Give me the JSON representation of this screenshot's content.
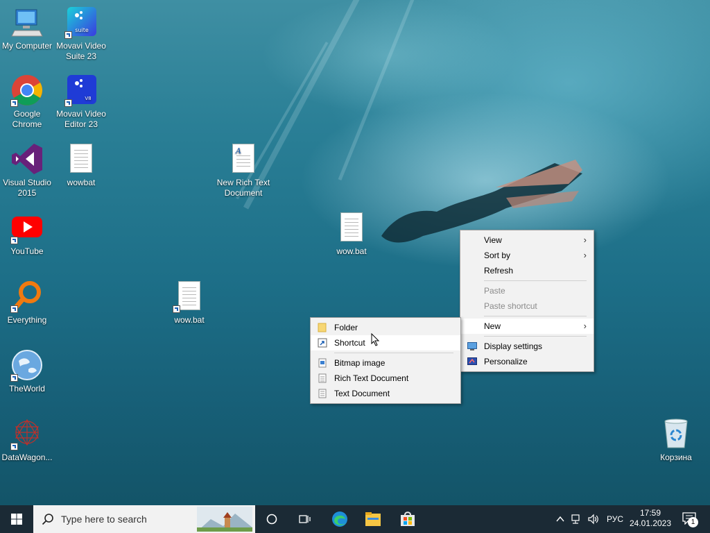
{
  "desktop": {
    "icons": [
      {
        "label": "My Computer"
      },
      {
        "label": "Movavi Video Suite 23",
        "badge": "suite"
      },
      {
        "label": "Google Chrome"
      },
      {
        "label": "Movavi Video Editor 23",
        "badge": "V8"
      },
      {
        "label": "Visual Studio 2015"
      },
      {
        "label": "wowbat"
      },
      {
        "label": "New Rich Text Document"
      },
      {
        "label": "YouTube"
      },
      {
        "label": "wow.bat"
      },
      {
        "label": "Everything"
      },
      {
        "label": "wow.bat"
      },
      {
        "label": "TheWorld"
      },
      {
        "label": "DataWagon..."
      },
      {
        "label": "Корзина"
      }
    ]
  },
  "context_menu": {
    "items": [
      {
        "label": "View"
      },
      {
        "label": "Sort by"
      },
      {
        "label": "Refresh"
      },
      {
        "label": "Paste"
      },
      {
        "label": "Paste shortcut"
      },
      {
        "label": "New"
      },
      {
        "label": "Display settings"
      },
      {
        "label": "Personalize"
      }
    ]
  },
  "new_submenu": {
    "items": [
      {
        "label": "Folder"
      },
      {
        "label": "Shortcut"
      },
      {
        "label": "Bitmap image"
      },
      {
        "label": "Rich Text Document"
      },
      {
        "label": "Text Document"
      }
    ]
  },
  "taskbar": {
    "search_placeholder": "Type here to search",
    "language": "РУС",
    "time": "17:59",
    "date": "24.01.2023",
    "notification_count": "1"
  },
  "colors": {
    "taskbar": "#1b2a35",
    "menu_bg": "#f2f2f2",
    "accent": "#1a5fb4"
  }
}
